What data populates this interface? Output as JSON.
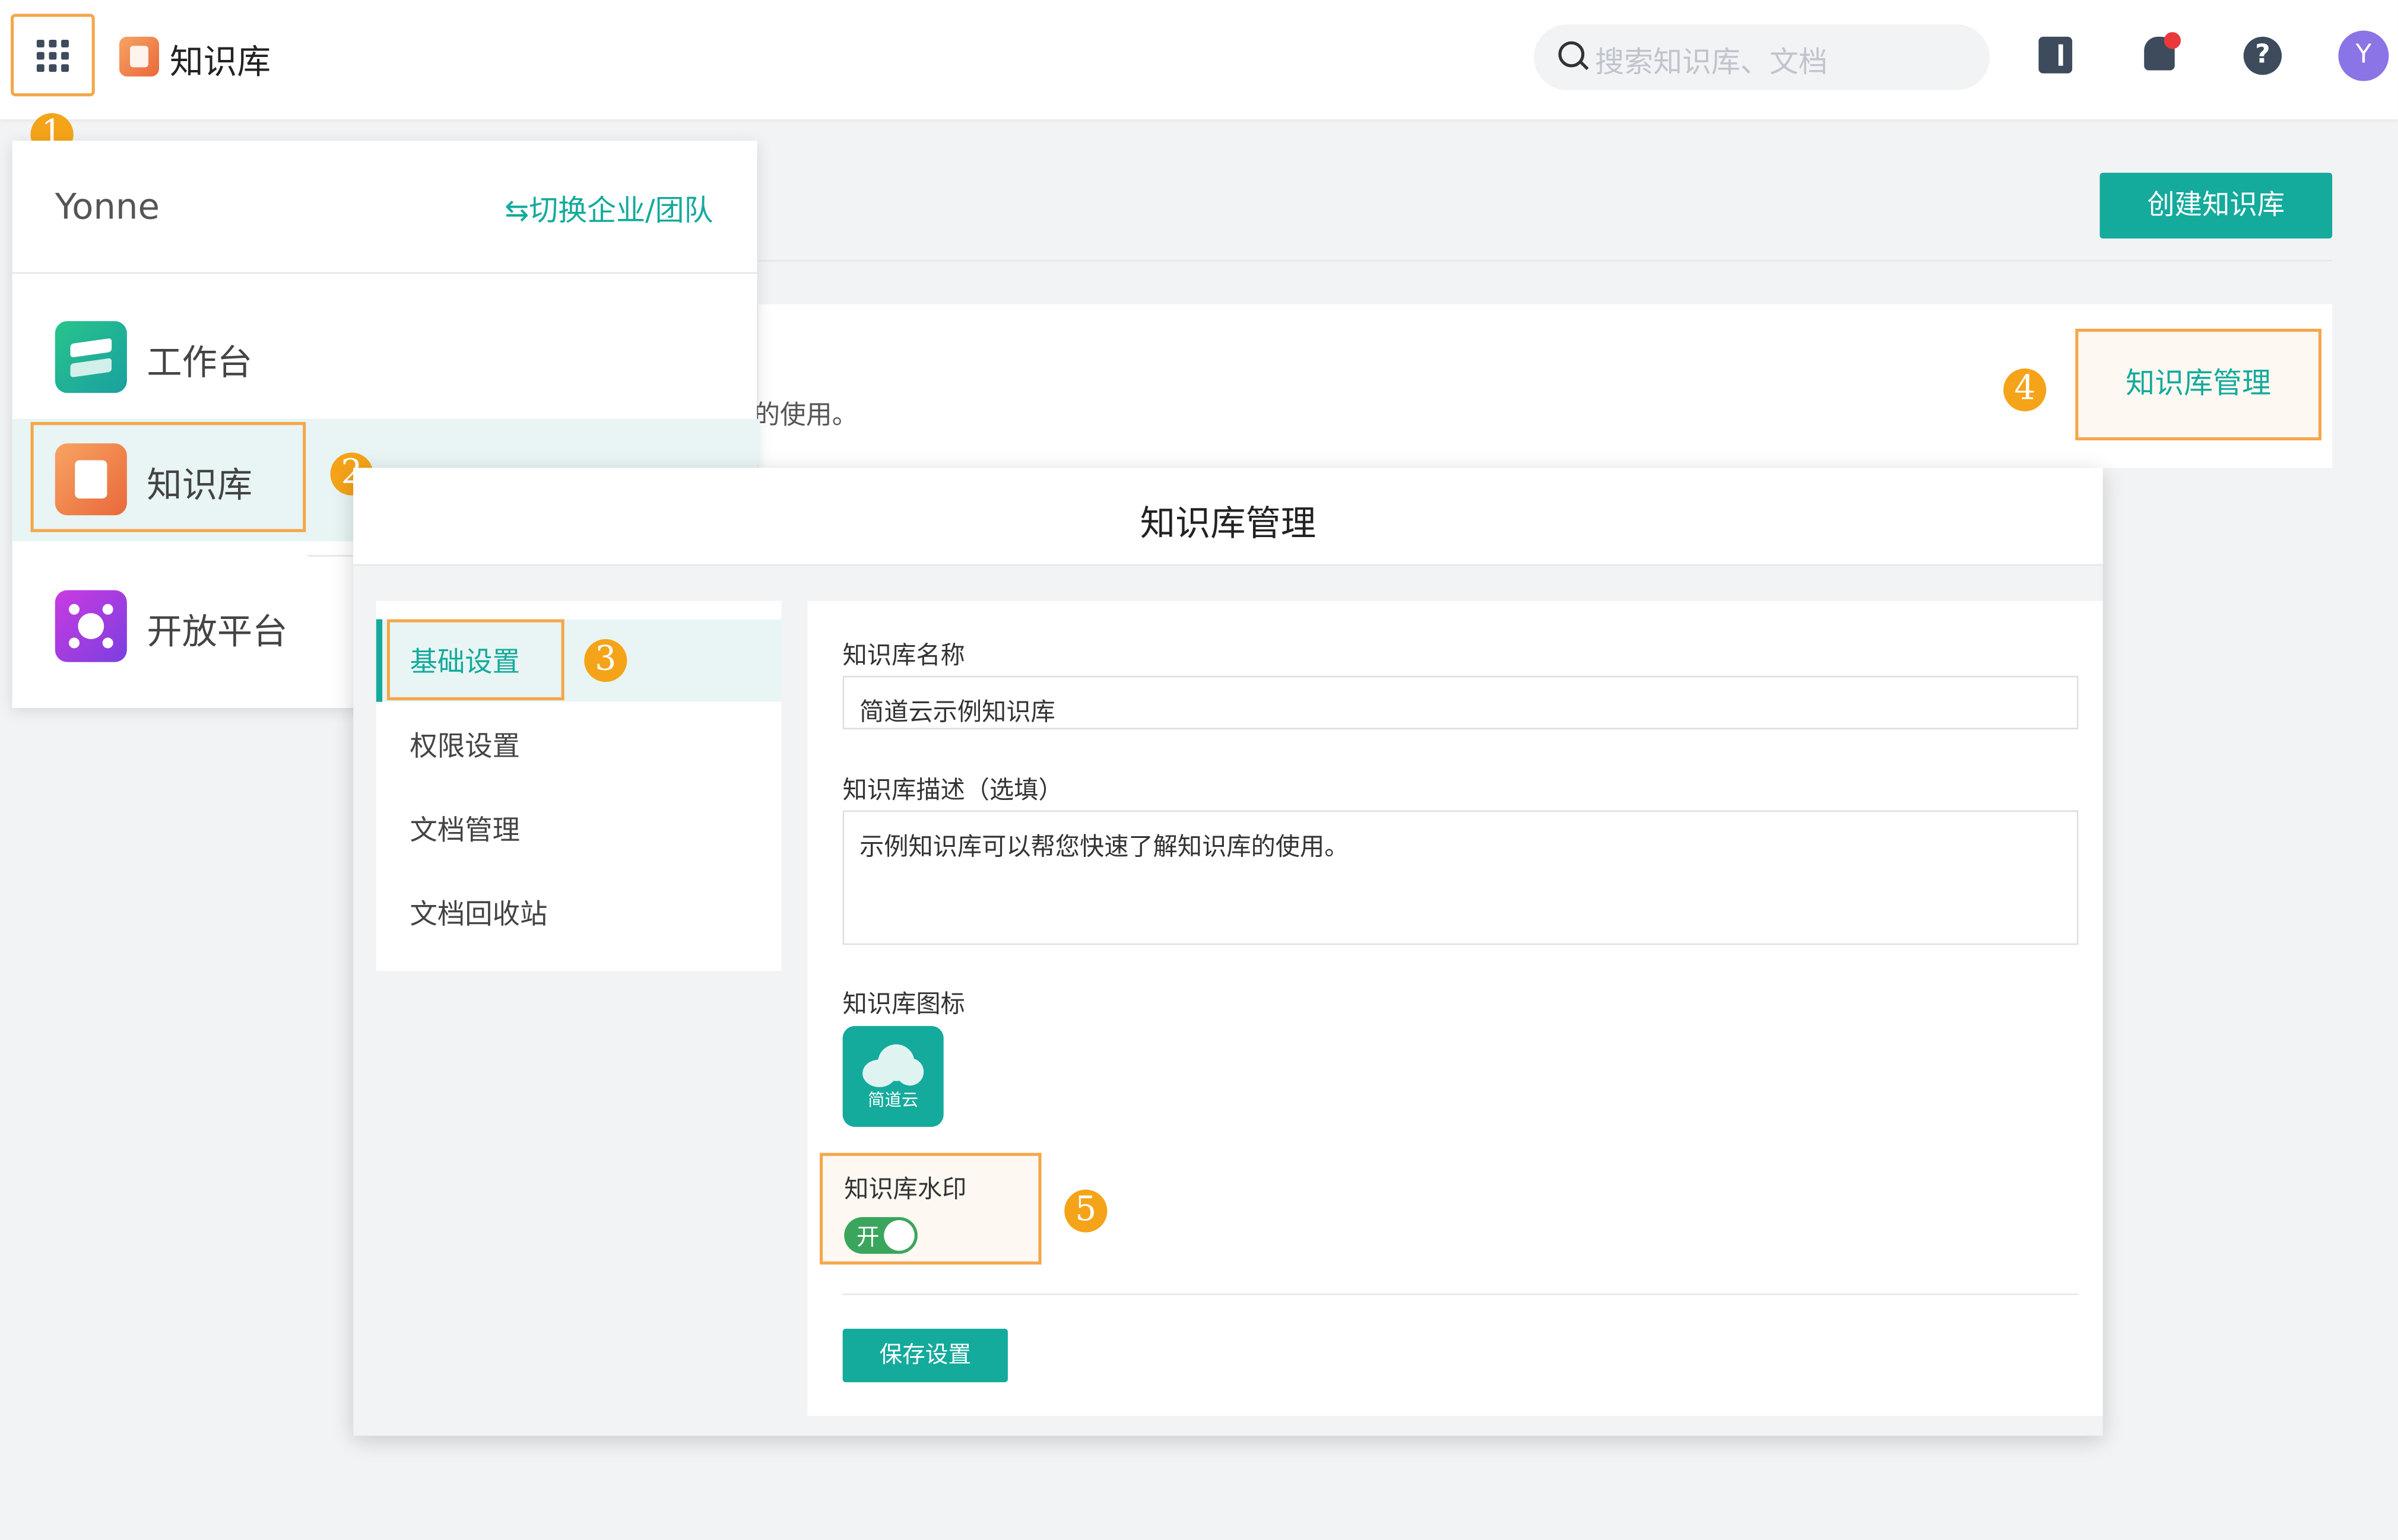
{
  "topbar": {
    "app_title": "知识库",
    "search_placeholder": "搜索知识库、文档",
    "avatar_initial": "Y"
  },
  "markers": [
    "1",
    "2",
    "3",
    "4",
    "5"
  ],
  "main": {
    "create_button": "创建知识库",
    "kb_card_desc_fragment": "的使用。",
    "manage_button": "知识库管理"
  },
  "switcher": {
    "user": "Yonne",
    "switch_link": "⇆切换企业/团队",
    "items": [
      {
        "label": "工作台"
      },
      {
        "label": "知识库"
      },
      {
        "label": "开放平台"
      }
    ]
  },
  "dialog": {
    "title": "知识库管理",
    "menu": [
      {
        "label": "基础设置"
      },
      {
        "label": "权限设置"
      },
      {
        "label": "文档管理"
      },
      {
        "label": "文档回收站"
      }
    ],
    "form": {
      "name_label": "知识库名称",
      "name_value": "简道云示例知识库",
      "desc_label": "知识库描述（选填）",
      "desc_value": "示例知识库可以帮您快速了解知识库的使用。",
      "icon_label": "知识库图标",
      "icon_text": "简道云",
      "watermark_label": "知识库水印",
      "watermark_toggle": "开",
      "save_button": "保存设置"
    }
  },
  "colors": {
    "accent": "#14aa9c",
    "highlight": "#f4a74b",
    "marker": "#f5a318"
  }
}
